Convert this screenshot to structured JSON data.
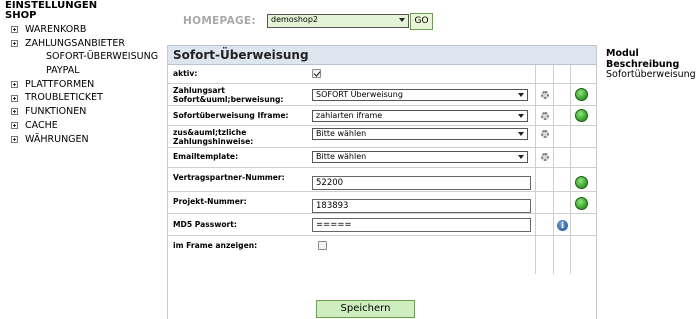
{
  "sidebar": {
    "title_line1": "EINSTELLUNGEN",
    "title_line2": "SHOP",
    "items": [
      {
        "label": "WARENKORB"
      },
      {
        "label": "ZAHLUNGSANBIETER"
      },
      {
        "label": "SOFORT-ÜBERWEISUNG"
      },
      {
        "label": "PAYPAL"
      },
      {
        "label": "PLATTFORMEN"
      },
      {
        "label": "TROUBLETICKET"
      },
      {
        "label": "FUNKTIONEN"
      },
      {
        "label": "CACHE"
      },
      {
        "label": "WÄHRUNGEN"
      }
    ]
  },
  "homepage": {
    "label": "HOMEPAGE:",
    "selected": "demoshop2",
    "go_label": "GO"
  },
  "panel": {
    "title": "Sofort-Überweisung",
    "rows": {
      "aktiv": {
        "label": "aktiv:",
        "checked": true
      },
      "zahlungsart": {
        "label1": "Zahlungsart",
        "label2": "Sofort&uuml;berweisung:",
        "value": "SOFORT Überweisung"
      },
      "iframe": {
        "label": "Sofortüberweisung Iframe:",
        "value": "zahlarten iframe"
      },
      "hinweise": {
        "label1": "zus&auml;tzliche",
        "label2": "Zahlungshinweise:",
        "value": "Bitte wählen"
      },
      "emailtemplate": {
        "label": "Emailtemplate:",
        "value": "Bitte wählen"
      },
      "vertragspartner": {
        "label": "Vertragspartner-Nummer:",
        "value": "52200"
      },
      "projekt": {
        "label": "Projekt-Nummer:",
        "value": "183893"
      },
      "md5": {
        "label": "MD5 Passwort:",
        "value": "=====",
        "info_icon": "i"
      },
      "frame": {
        "label": "im Frame anzeigen:",
        "checked": false
      }
    },
    "save_label": "Speichern"
  },
  "modul": {
    "heading1": "Modul",
    "heading2": "Beschreibung",
    "value": "Sofortüberweisung"
  },
  "colors": {
    "panel_header": "#dde5ef",
    "button_green": "#cfeec0",
    "status_green": "#2f9b25",
    "homepage_select": "#e3f3d6"
  }
}
